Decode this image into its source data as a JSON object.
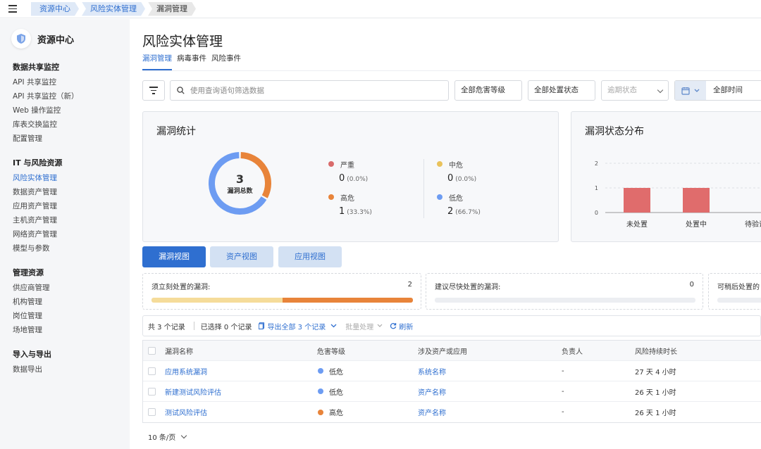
{
  "breadcrumb": [
    "资源中心",
    "风险实体管理",
    "漏洞管理"
  ],
  "sidebar": {
    "title": "资源中心",
    "groups": [
      {
        "title": "数据共享监控",
        "items": [
          "API 共享监控",
          "API 共享监控（新）",
          "Web 操作监控",
          "库表交换监控",
          "配置管理"
        ]
      },
      {
        "title": "IT 与风险资源",
        "items": [
          "风险实体管理",
          "数据资产管理",
          "应用资产管理",
          "主机资产管理",
          "网络资产管理",
          "模型与参数"
        ]
      },
      {
        "title": "管理资源",
        "items": [
          "供应商管理",
          "机构管理",
          "岗位管理",
          "场地管理"
        ]
      },
      {
        "title": "导入与导出",
        "items": [
          "数据导出"
        ]
      }
    ],
    "active_item": "风险实体管理"
  },
  "page": {
    "title": "风险实体管理",
    "tabs": [
      "漏洞管理",
      "病毒事件",
      "风险事件"
    ],
    "active_tab": "漏洞管理"
  },
  "filters": {
    "search_placeholder": "使用查询语句筛选数据",
    "severity": "全部危害等级",
    "status": "全部处置状态",
    "overdue": "逾期状态",
    "time": "全部时间"
  },
  "stats": {
    "title": "漏洞统计",
    "total": "3",
    "total_label": "漏洞总数",
    "items": [
      {
        "name": "严重",
        "count": "0",
        "pct": "(0.0%)",
        "color": "#d96b6b",
        "value": 0
      },
      {
        "name": "高危",
        "count": "1",
        "pct": "(33.3%)",
        "color": "#e8843a",
        "value": 1
      },
      {
        "name": "中危",
        "count": "0",
        "pct": "(0.0%)",
        "color": "#e9c25b",
        "value": 0
      },
      {
        "name": "低危",
        "count": "2",
        "pct": "(66.7%)",
        "color": "#6d9cf2",
        "value": 2
      }
    ]
  },
  "status_chart": {
    "title": "漏洞状态分布",
    "y_ticks": [
      "2",
      "1",
      "0"
    ],
    "chart_data": {
      "type": "bar",
      "categories": [
        "未处置",
        "处置中",
        "待验证"
      ],
      "values": [
        1,
        1,
        0
      ],
      "ylim": [
        0,
        2
      ],
      "color": "#e06c6c"
    }
  },
  "views": [
    "漏洞视图",
    "资产视图",
    "应用视图"
  ],
  "active_view": "漏洞视图",
  "priority_cards": [
    {
      "label": "须立刻处置的漏洞:",
      "count": "2",
      "segments": [
        {
          "color": "#f5dc9a",
          "value": 1
        },
        {
          "color": "#e8843a",
          "value": 1
        }
      ]
    },
    {
      "label": "建议尽快处置的漏洞:",
      "count": "0",
      "segments": []
    },
    {
      "label": "可稍后处置的",
      "count": "",
      "segments": []
    }
  ],
  "toolbar": {
    "total": "共 3 个记录",
    "selected": "已选择 0 个记录",
    "export": "导出全部 3 个记录",
    "batch": "批量处理",
    "refresh": "刷新"
  },
  "table": {
    "columns": [
      "漏洞名称",
      "危害等级",
      "涉及资产或应用",
      "负责人",
      "风险持续时长"
    ],
    "rows": [
      {
        "name": "应用系统漏洞",
        "level": "低危",
        "level_color": "#6d9cf2",
        "asset": "系统名称",
        "owner": "-",
        "duration": "27 天 4 小时"
      },
      {
        "name": "新建测试风险评估",
        "level": "低危",
        "level_color": "#6d9cf2",
        "asset": "资产名称",
        "owner": "-",
        "duration": "26 天 1 小时"
      },
      {
        "name": "测试风险评估",
        "level": "高危",
        "level_color": "#e8843a",
        "asset": "资产名称",
        "owner": "-",
        "duration": "26 天 1 小时"
      }
    ]
  },
  "pager": {
    "page_size": "10 条/页"
  }
}
